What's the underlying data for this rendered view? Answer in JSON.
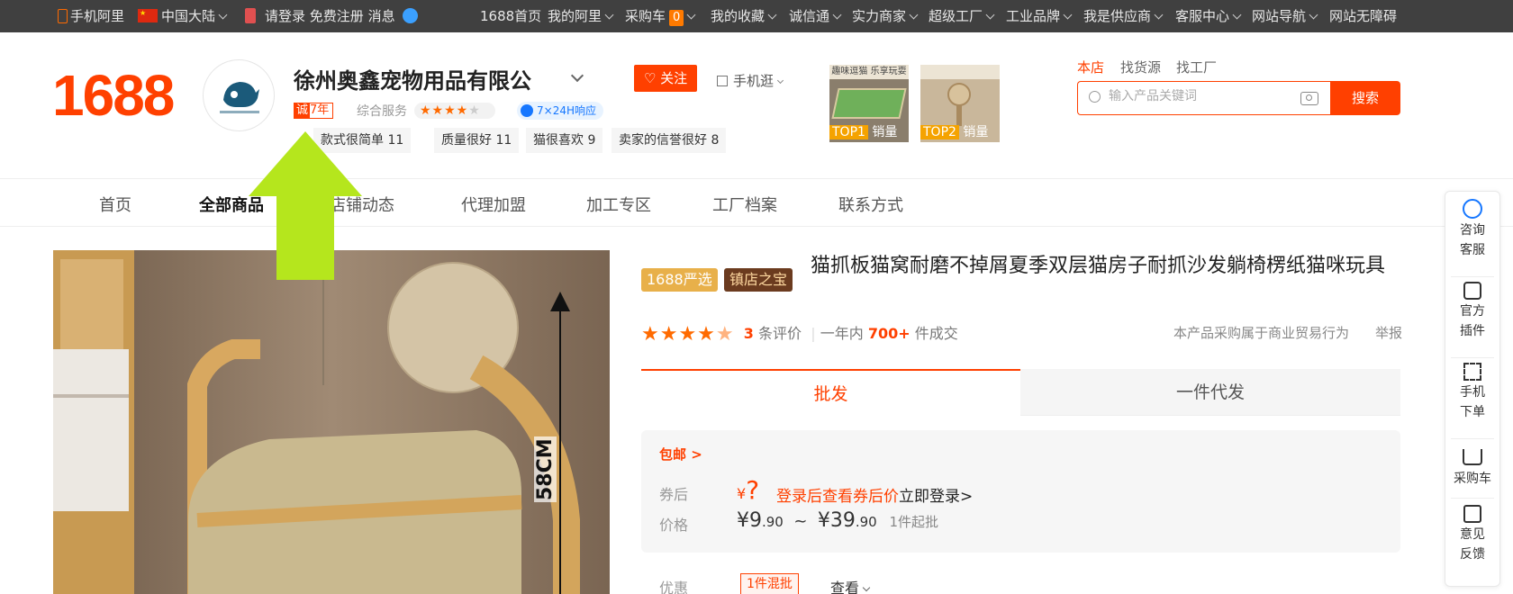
{
  "topbar": {
    "mobile_ali": "手机阿里",
    "region": "中国大陆",
    "login": "请登录",
    "register": "免费注册",
    "messages": "消息",
    "home_1688": "1688首页",
    "my_ali": "我的阿里",
    "cart": "采购车",
    "cart_count": "0",
    "favorites": "我的收藏",
    "chengxintong": "诚信通",
    "strong_merchant": "实力商家",
    "super_factory": "超级工厂",
    "industrial_brand": "工业品牌",
    "i_am_supplier": "我是供应商",
    "service_center": "客服中心",
    "site_nav": "网站导航",
    "accessibility": "网站无障碍"
  },
  "header": {
    "logo": "1688",
    "shop_name": "徐州奥鑫宠物用品有限公",
    "chengxin_char": "诚",
    "chengxin_years": "7年",
    "service_label": "综合服务",
    "service_stars": "★★★★",
    "service_star_empty": "★",
    "response": "7×24H响应",
    "follow": "关注",
    "mobile_browse": "手机逛",
    "tags": [
      "款式很简单 11",
      "质量很好 11",
      "猫很喜欢 9",
      "卖家的信誉很好 8"
    ],
    "thumbs": [
      {
        "rank": "TOP1",
        "label": "销量",
        "caption": "趣味逗猫 乐享玩耍"
      },
      {
        "rank": "TOP2",
        "label": "销量"
      }
    ],
    "search_tabs": [
      "本店",
      "找货源",
      "找工厂"
    ],
    "search_placeholder": "输入产品关键词",
    "search_button": "搜索"
  },
  "nav": [
    "首页",
    "全部商品",
    "店铺动态",
    "代理加盟",
    "加工专区",
    "工厂档案",
    "联系方式"
  ],
  "sidebar": [
    {
      "line1": "咨询",
      "line2": "客服"
    },
    {
      "line1": "官方",
      "line2": "插件"
    },
    {
      "line1": "手机",
      "line2": "下单"
    },
    {
      "line1": "采购车",
      "line2": ""
    },
    {
      "line1": "意见",
      "line2": "反馈"
    }
  ],
  "product": {
    "badge_yanxuan": "1688严选",
    "badge_zhendian": "镇店之宝",
    "title": "猫抓板猫窝耐磨不掉屑夏季双层猫房子耐抓沙发躺椅楞纸猫咪玩具",
    "image_dimension": "58CM",
    "rating_stars": "★★★★",
    "review_count": "3",
    "review_label": "条评价",
    "sales_prefix": "一年内",
    "sales_count": "700+",
    "sales_suffix": "件成交",
    "trade_note": "本产品采购属于商业贸易行为",
    "report": "举报",
    "tab_wholesale": "批发",
    "tab_dropship": "一件代发",
    "free_shipping": "包邮 >",
    "coupon_label": "券后",
    "coupon_currency": "¥",
    "coupon_value": "?",
    "coupon_login_text": "登录后查看券后价",
    "coupon_login_link": "立即登录>",
    "price_label": "价格",
    "price_low_int": "¥9",
    "price_low_dec": ".90",
    "price_sep": "~",
    "price_high_int": "¥39",
    "price_high_dec": ".90",
    "moq": "1件起批",
    "discount_label": "优惠",
    "mixed_batch": "1件混批",
    "view": "查看"
  },
  "colors": {
    "brand": "#ff4000",
    "topbar": "#404040",
    "star": "#ff6a00",
    "arrow": "#b5e61d"
  }
}
